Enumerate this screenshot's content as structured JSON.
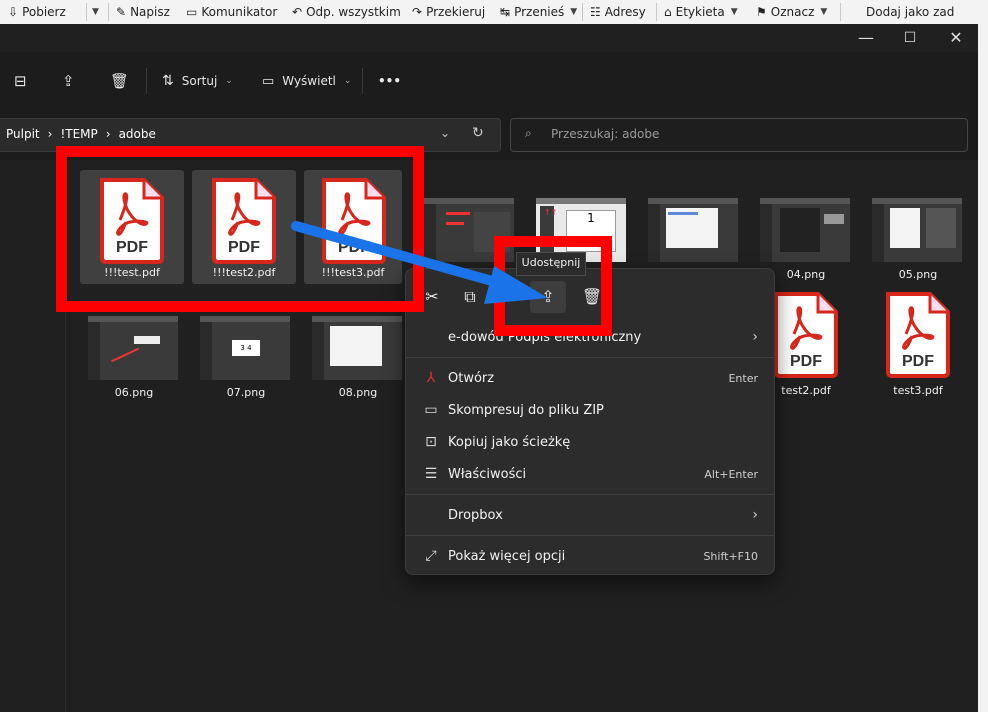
{
  "mail_toolbar": {
    "items": [
      {
        "label": "Pobierz",
        "icon": "download-icon",
        "dropdown": true
      },
      {
        "label": "Napisz",
        "icon": "pen-icon"
      },
      {
        "label": "Komunikator",
        "icon": "chat-icon"
      },
      {
        "label": "Odp. wszystkim",
        "icon": "reply-all-icon"
      },
      {
        "label": "Przekieruj",
        "icon": "forward-icon"
      },
      {
        "label": "Przenieś",
        "icon": "move-icon",
        "dropdown": true
      },
      {
        "label": "Adresy",
        "icon": "address-book-icon"
      },
      {
        "label": "Etykieta",
        "icon": "tag-icon",
        "dropdown": true
      },
      {
        "label": "Oznacz",
        "icon": "bookmark-icon",
        "dropdown": true
      },
      {
        "label": "Dodaj jako zad"
      }
    ]
  },
  "window": {
    "controls": {
      "minimize": "—",
      "maximize": "☐",
      "close": "✕"
    },
    "command_bar": {
      "sort_label": "Sortuj",
      "view_label": "Wyświetl",
      "more": "•••"
    },
    "breadcrumb": [
      "Pulpit",
      "!TEMP",
      "adobe"
    ],
    "search_placeholder": "Przeszukaj: adobe"
  },
  "files_row1": [
    {
      "name": "!!!test.pdf",
      "type": "pdf"
    },
    {
      "name": "!!!test2.pdf",
      "type": "pdf"
    },
    {
      "name": "!!!test3.pdf",
      "type": "pdf"
    },
    {
      "name": "",
      "type": "png"
    },
    {
      "name": "",
      "type": "png"
    },
    {
      "name": "",
      "type": "png"
    },
    {
      "name": "04.png",
      "type": "png"
    },
    {
      "name": "05.png",
      "type": "png"
    }
  ],
  "files_row2": [
    {
      "name": "06.png",
      "type": "png"
    },
    {
      "name": "07.png",
      "type": "png"
    },
    {
      "name": "08.png",
      "type": "png"
    },
    {
      "name": "test2.pdf",
      "type": "pdf"
    },
    {
      "name": "test3.pdf",
      "type": "pdf"
    }
  ],
  "pdf_label": "PDF",
  "tooltip": "Udostępnij",
  "context_menu": {
    "quick_actions": [
      "cut-icon",
      "copy-icon",
      "share-icon",
      "delete-icon"
    ],
    "items": [
      {
        "label": "e-dowód Podpis elektroniczny",
        "submenu": true
      },
      {
        "label": "Otwórz",
        "shortcut": "Enter",
        "icon": "acrobat-icon"
      },
      {
        "label": "Skompresuj do pliku ZIP",
        "icon": "zip-folder-icon"
      },
      {
        "label": "Kopiuj jako ścieżkę",
        "icon": "copy-path-icon"
      },
      {
        "label": "Właściwości",
        "shortcut": "Alt+Enter",
        "icon": "properties-icon"
      },
      {
        "label": "Dropbox",
        "submenu": true
      },
      {
        "label": "Pokaż więcej opcji",
        "shortcut": "Shift+F10",
        "icon": "more-options-icon"
      }
    ]
  },
  "colors": {
    "annotation_red": "#ff0000",
    "annotation_arrow": "#1a73e8",
    "pdf_red": "#d7261b",
    "explorer_bg": "#202020"
  }
}
